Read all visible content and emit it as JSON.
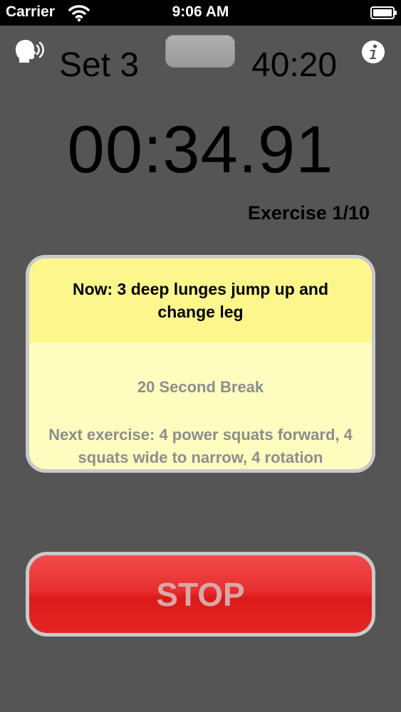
{
  "status_bar": {
    "carrier": "Carrier",
    "time": "9:06 AM",
    "icons": [
      "wifi-icon",
      "battery-icon"
    ]
  },
  "header": {
    "set_label": "Set 3",
    "total_time": "40:20",
    "icons": [
      "speech-icon",
      "info-icon"
    ]
  },
  "timer": {
    "value": "00:34.91",
    "exercise_counter": "Exercise 1/10"
  },
  "card": {
    "now_text": "Now: 3 deep lunges jump up and change leg",
    "break_text": "20 Second Break",
    "next_text": "Next exercise: 4 power squats forward, 4 squats wide to narrow, 4 rotation"
  },
  "stop_button": {
    "label": "STOP"
  },
  "colors": {
    "background": "#555555",
    "card_now": "#fdf68c",
    "card_body": "#fffcc0",
    "stop_red": "#e42424"
  }
}
